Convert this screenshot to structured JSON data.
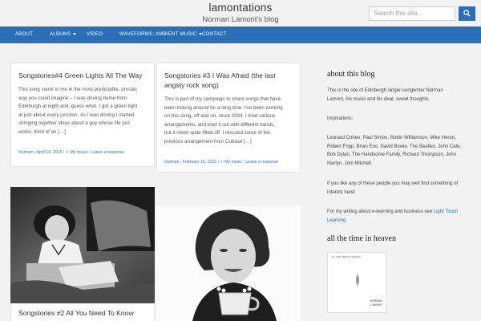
{
  "header": {
    "site_title": "lamontations",
    "tagline": "Norman Lamont's blog",
    "search_placeholder": "Search this site..."
  },
  "nav": {
    "items": [
      {
        "label": "ABOUT"
      },
      {
        "label": "ALBUMS"
      },
      {
        "label": "VIDEO"
      },
      {
        "label": "WAVEFORMS: AMBIENT MUSIC"
      },
      {
        "label": "CONTACT"
      }
    ]
  },
  "posts": [
    {
      "title": "Songstories#4 Green Lights All The Way",
      "excerpt": [
        "This song came to me in the most predictable, prosaic",
        "way you could imagine – I was driving home from",
        "Edinburgh at night and, guess what, I got a green light",
        "at just about every junction. As I was driving I started",
        "stringing together ideas about a guy whose life just",
        "works. Kind of an […]"
      ],
      "author": "Norman",
      "date": "April 14, 2015",
      "category_prefix": "In",
      "category": "My music",
      "comment": "Leave a response"
    },
    {
      "title_lines": [
        "Songstories #3 I Was Afraid (the last",
        "angsty rock song)"
      ],
      "excerpt": [
        "This is part of my campaign to share songs that have",
        "been kicking around for a long time. I've been working",
        "on this song, off and on, since 2004. I tried various",
        "arrangements, and tried it out with different bands,",
        "but it never quite lifted off. I rescued some of the",
        "previous arrangement from Cubase […]"
      ],
      "author": "Norman",
      "date": "February 19, 2015",
      "category_prefix": "In",
      "category": "My music",
      "comment": "Leave a response"
    },
    {
      "title": "Songstories #2 All You Need To Know"
    }
  ],
  "sidebar": {
    "about_heading": "about this blog",
    "about_p1": [
      "This is the site of Edinburgh singer-songwriter Norman",
      "Lamont, his music and his dear, sweet thoughts."
    ],
    "inspirations_label": "Inspirations:",
    "inspirations": [
      "Leonard Cohen, Paul Simon, Robin Williamson, Mike Heron,",
      "Robert Fripp, Brian Eno, David Bowie, The Beatles, John Cale,",
      "Bob Dylan, The Handsome Family, Richard Thompson, John",
      "Martyn, Joni Mitchell."
    ],
    "like_text": [
      "If you like any of these people you may well find something of",
      "interest here!"
    ],
    "writing_text": "For my writing about e-learning and business see",
    "writing_link": [
      "Light Touch",
      "Learning"
    ],
    "album_heading": "all the time in heaven",
    "album_cover_title": "ALL THE TIME IN HEAVEN",
    "album_cover_artist": [
      "NORMAN",
      "LAMONT"
    ]
  }
}
